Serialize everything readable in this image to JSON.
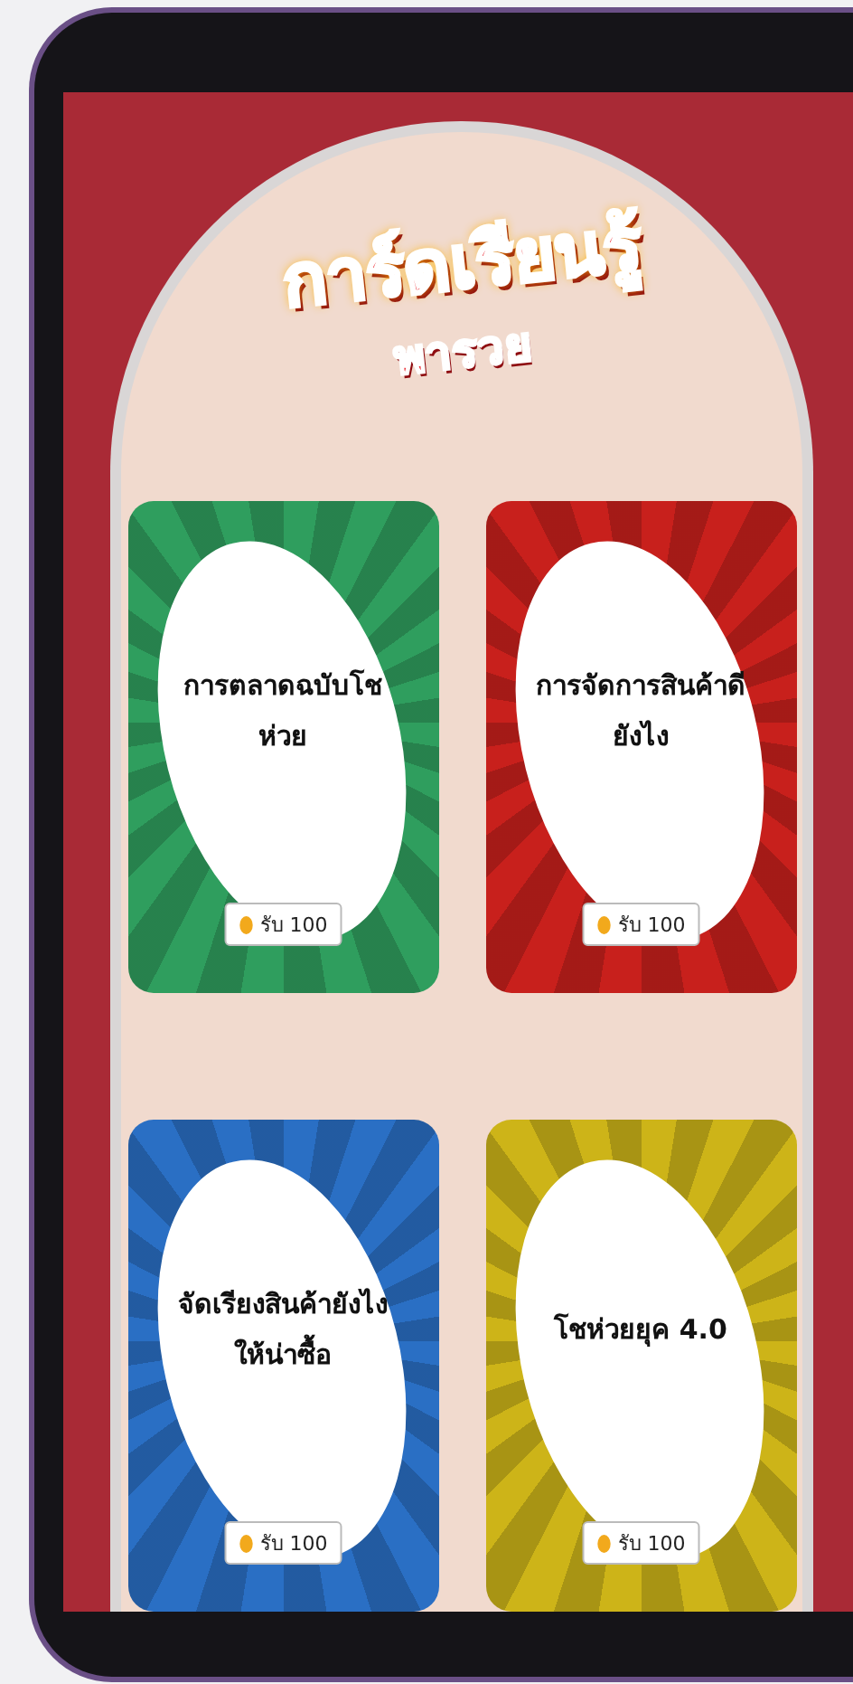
{
  "logo": {
    "title": "การ์ดเรียนรู้",
    "subtitle": "พารวย"
  },
  "cards": [
    {
      "title": "การตลาดฉบับโชห่วย",
      "reward": "รับ 100",
      "color": "#2f9e5e"
    },
    {
      "title": "การจัดการสินค้าดียังไง",
      "reward": "รับ 100",
      "color": "#c8201c"
    },
    {
      "title": "จัดเรียงสินค้ายังไงให้น่าซื้อ",
      "reward": "รับ 100",
      "color": "#2a6fc4"
    },
    {
      "title": "โชห่วยยุค 4.0",
      "reward": "รับ 100",
      "color": "#cdb418"
    }
  ]
}
